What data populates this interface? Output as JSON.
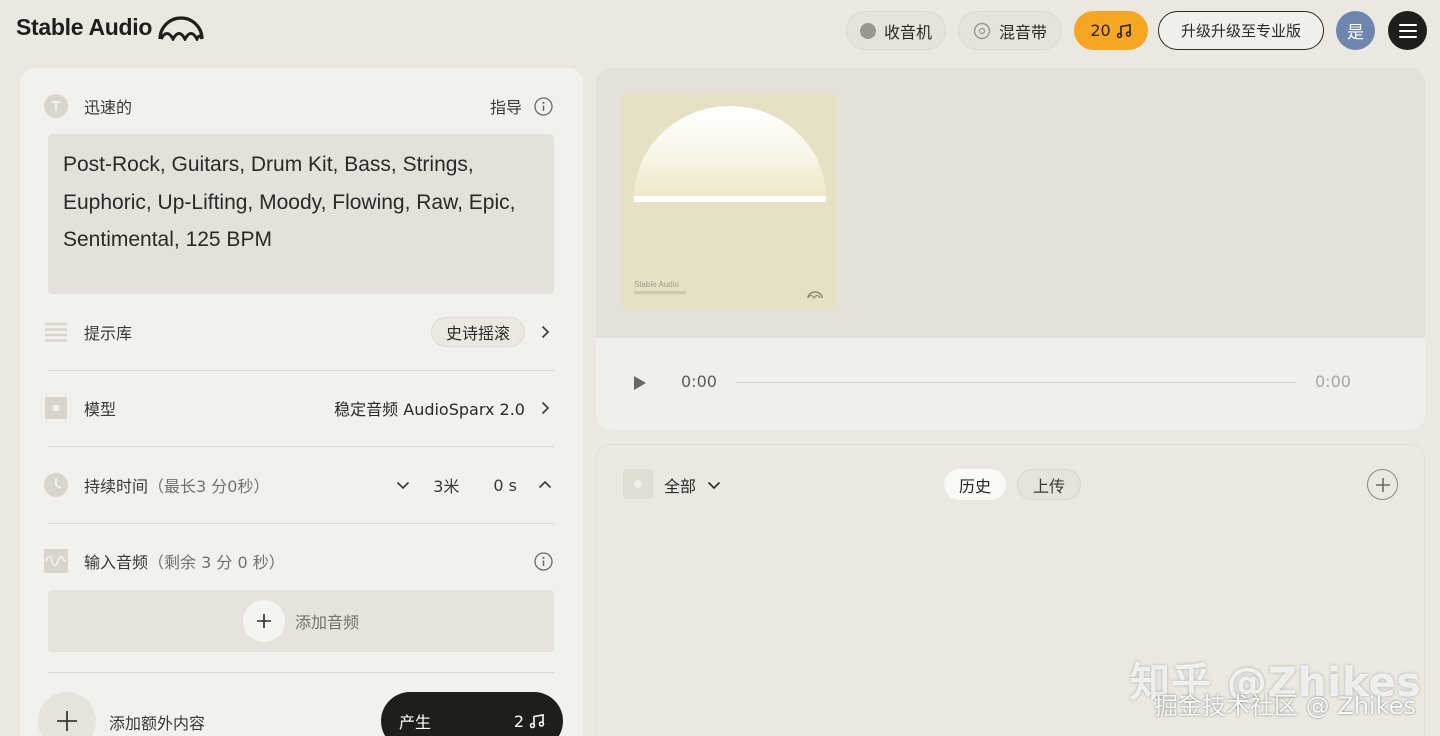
{
  "header": {
    "brand": "Stable Audio",
    "radio_label": "收音机",
    "mixtape_label": "混音带",
    "credits": "20",
    "upgrade_label": "升级升级至专业版",
    "avatar_initial": "是"
  },
  "prompt": {
    "section_label": "迅速的",
    "guide_label": "指导",
    "text": "Post-Rock, Guitars, Drum Kit, Bass, Strings, Euphoric, Up-Lifting, Moody, Flowing, Raw, Epic, Sentimental, 125 BPM"
  },
  "prompt_library": {
    "label": "提示库",
    "selected": "史诗摇滚"
  },
  "model": {
    "label": "模型",
    "value": "稳定音频 AudioSparx 2.0"
  },
  "duration": {
    "label": "持续时间",
    "hint": "（最长3 分0秒）",
    "minutes": "3米",
    "seconds": "0 s"
  },
  "input_audio": {
    "label": "输入音频",
    "hint": "（剩余 3 分 0 秒）",
    "add_label": "添加音频"
  },
  "footer": {
    "add_extra_label": "添加额外内容",
    "generate_label": "产生",
    "generate_cost": "2"
  },
  "player": {
    "cover_brand": "Stable Audio",
    "time_current": "0:00",
    "time_total": "0:00",
    "progress": 0
  },
  "library": {
    "filter_label": "全部",
    "tab_history": "历史",
    "tab_upload": "上传"
  },
  "watermark": {
    "line1": "知乎 @Zhikes",
    "line2": "掘金技术社区 @ Zhikes"
  },
  "colors": {
    "accent": "#f5a623",
    "background": "#ebe8e1",
    "panel": "#f3f1ed",
    "dark": "#1f1e1b",
    "avatar": "#6e86ae"
  },
  "icons": {
    "brand_logo": "sound-wave-dome-icon",
    "radio": "radio-dot-icon",
    "mixtape": "cassette-icon",
    "credits": "music-note-icon",
    "menu": "hamburger-icon",
    "prompt": "text-t-icon",
    "info": "info-icon",
    "library": "list-lines-icon",
    "model": "square-model-icon",
    "duration": "clock-icon",
    "input_audio": "waveform-icon",
    "play": "play-icon",
    "add": "plus-icon",
    "chevron": "chevron-icon"
  }
}
